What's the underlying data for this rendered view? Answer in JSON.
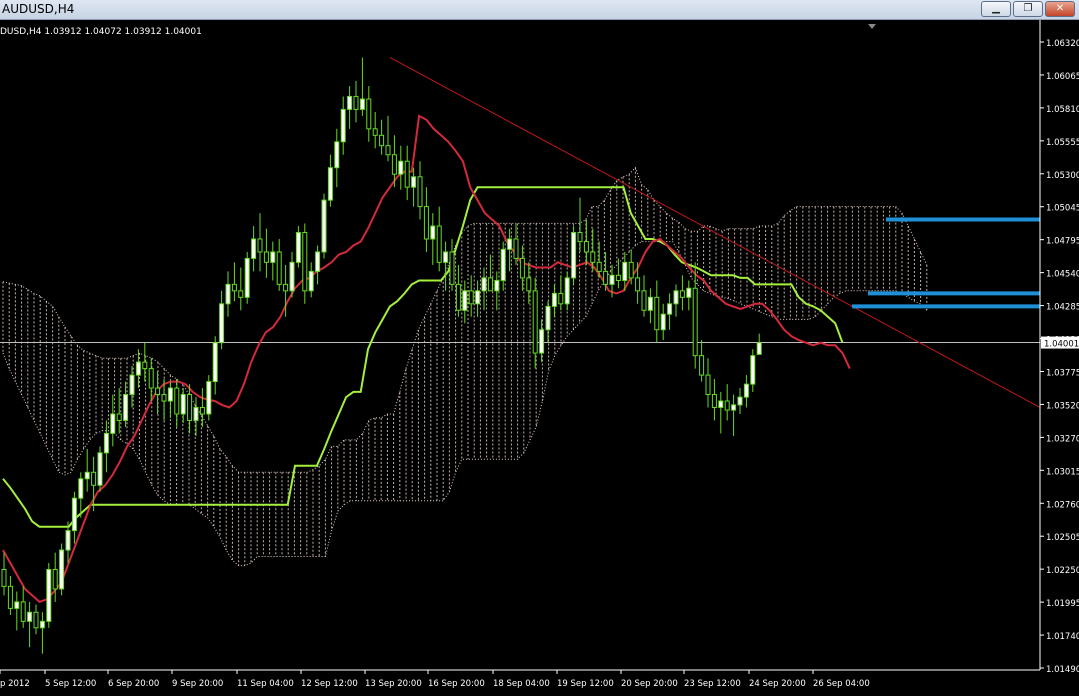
{
  "window": {
    "title": "AUDUSD,H4",
    "buttons": [
      "minimize",
      "restore",
      "close"
    ]
  },
  "chart_data": {
    "type": "candlestick",
    "symbol_info": "DUSD,H4  1.03912 1.04072 1.03912 1.04001",
    "timeframe": "H4",
    "ylim": [
      1.0149,
      1.0632
    ],
    "y_ticks": [
      "1.06320",
      "1.06065",
      "1.05810",
      "1.05555",
      "1.05300",
      "1.05045",
      "1.04795",
      "1.04540",
      "1.04285",
      "1.04030",
      "1.03775",
      "1.03520",
      "1.03270",
      "1.03015",
      "1.02760",
      "1.02505",
      "1.02250",
      "1.01995",
      "1.01740",
      "1.01490"
    ],
    "x_ticks": [
      "p 2012",
      "5 Sep 12:00",
      "6 Sep 20:00",
      "9 Sep 20:00",
      "11 Sep 04:00",
      "12 Sep 12:00",
      "13 Sep 20:00",
      "16 Sep 20:00",
      "18 Sep 04:00",
      "19 Sep 12:00",
      "20 Sep 20:00",
      "23 Sep 12:00",
      "24 Sep 20:00",
      "26 Sep 04:00"
    ],
    "current_price": "1.04001",
    "colors": {
      "background": "#000000",
      "axis_text": "#ffffff",
      "bull_candle": "#ffffff",
      "bear_candle": "#000000",
      "wick": "#66dd22",
      "tenkan": "#d42a3c",
      "kijun": "#a4f03c",
      "cloud": "#e8d0c8",
      "trendline": "#c01818",
      "support_lines": "#1f8fd6",
      "price_line": "#c0c0c0"
    },
    "candles": [
      [
        1.0225,
        1.0238,
        1.0205,
        1.0212
      ],
      [
        1.0212,
        1.022,
        1.019,
        1.0195
      ],
      [
        1.0195,
        1.0208,
        1.0178,
        1.02
      ],
      [
        1.02,
        1.0212,
        1.018,
        1.0185
      ],
      [
        1.0185,
        1.02,
        1.0165,
        1.0192
      ],
      [
        1.0192,
        1.0198,
        1.0175,
        1.018
      ],
      [
        1.018,
        1.0192,
        1.016,
        1.0185
      ],
      [
        1.0185,
        1.023,
        1.018,
        1.0225
      ],
      [
        1.0225,
        1.0238,
        1.02,
        1.021
      ],
      [
        1.021,
        1.0245,
        1.0205,
        1.024
      ],
      [
        1.024,
        1.0262,
        1.023,
        1.0255
      ],
      [
        1.0255,
        1.0285,
        1.0245,
        1.028
      ],
      [
        1.028,
        1.03,
        1.0265,
        1.0295
      ],
      [
        1.0295,
        1.0318,
        1.0285,
        1.03
      ],
      [
        1.03,
        1.0312,
        1.027,
        1.029
      ],
      [
        1.029,
        1.032,
        1.0285,
        1.0315
      ],
      [
        1.0315,
        1.034,
        1.03,
        1.033
      ],
      [
        1.033,
        1.036,
        1.032,
        1.0345
      ],
      [
        1.0345,
        1.0365,
        1.033,
        1.034
      ],
      [
        1.034,
        1.037,
        1.0335,
        1.036
      ],
      [
        1.036,
        1.0382,
        1.035,
        1.0375
      ],
      [
        1.0375,
        1.0395,
        1.0365,
        1.0385
      ],
      [
        1.0385,
        1.04,
        1.037,
        1.038
      ],
      [
        1.038,
        1.0388,
        1.0355,
        1.0365
      ],
      [
        1.0365,
        1.0378,
        1.0345,
        1.036
      ],
      [
        1.036,
        1.0372,
        1.034,
        1.0355
      ],
      [
        1.0355,
        1.037,
        1.0342,
        1.0365
      ],
      [
        1.0365,
        1.0372,
        1.0335,
        1.0345
      ],
      [
        1.0345,
        1.0365,
        1.0338,
        1.036
      ],
      [
        1.036,
        1.0368,
        1.033,
        1.034
      ],
      [
        1.034,
        1.0358,
        1.0328,
        1.035
      ],
      [
        1.035,
        1.0365,
        1.0335,
        1.0345
      ],
      [
        1.0345,
        1.0375,
        1.034,
        1.037
      ],
      [
        1.037,
        1.0405,
        1.036,
        1.04
      ],
      [
        1.04,
        1.044,
        1.0395,
        1.043
      ],
      [
        1.043,
        1.0455,
        1.042,
        1.0445
      ],
      [
        1.0445,
        1.0462,
        1.0432,
        1.044
      ],
      [
        1.044,
        1.0458,
        1.0425,
        1.0435
      ],
      [
        1.0435,
        1.047,
        1.043,
        1.0465
      ],
      [
        1.0465,
        1.049,
        1.0455,
        1.048
      ],
      [
        1.048,
        1.05,
        1.0455,
        1.047
      ],
      [
        1.047,
        1.0488,
        1.045,
        1.0462
      ],
      [
        1.0462,
        1.0478,
        1.0448,
        1.047
      ],
      [
        1.047,
        1.048,
        1.044,
        1.0445
      ],
      [
        1.0445,
        1.046,
        1.042,
        1.044
      ],
      [
        1.044,
        1.047,
        1.0435,
        1.0462
      ],
      [
        1.0462,
        1.049,
        1.0458,
        1.0485
      ],
      [
        1.0485,
        1.0492,
        1.043,
        1.044
      ],
      [
        1.044,
        1.0462,
        1.0435,
        1.0455
      ],
      [
        1.0455,
        1.0475,
        1.0445,
        1.047
      ],
      [
        1.047,
        1.0515,
        1.0465,
        1.051
      ],
      [
        1.051,
        1.0545,
        1.0505,
        1.0535
      ],
      [
        1.0535,
        1.0565,
        1.052,
        1.0555
      ],
      [
        1.0555,
        1.059,
        1.0545,
        1.058
      ],
      [
        1.058,
        1.0598,
        1.0565,
        1.059
      ],
      [
        1.059,
        1.0602,
        1.057,
        1.058
      ],
      [
        1.058,
        1.062,
        1.0575,
        1.0588
      ],
      [
        1.0588,
        1.0598,
        1.0555,
        1.0565
      ],
      [
        1.0565,
        1.0578,
        1.055,
        1.056
      ],
      [
        1.056,
        1.0572,
        1.0545,
        1.0552
      ],
      [
        1.0552,
        1.0575,
        1.054,
        1.0545
      ],
      [
        1.0545,
        1.056,
        1.052,
        1.053
      ],
      [
        1.053,
        1.0552,
        1.0518,
        1.054
      ],
      [
        1.054,
        1.0552,
        1.051,
        1.052
      ],
      [
        1.052,
        1.0535,
        1.0505,
        1.0528
      ],
      [
        1.0528,
        1.054,
        1.0495,
        1.0505
      ],
      [
        1.0505,
        1.052,
        1.047,
        1.048
      ],
      [
        1.048,
        1.05,
        1.046,
        1.049
      ],
      [
        1.049,
        1.0505,
        1.0455,
        1.0462
      ],
      [
        1.0462,
        1.0478,
        1.044,
        1.047
      ],
      [
        1.047,
        1.048,
        1.044,
        1.0445
      ],
      [
        1.0445,
        1.046,
        1.042,
        1.0425
      ],
      [
        1.0425,
        1.0448,
        1.0415,
        1.044
      ],
      [
        1.044,
        1.0452,
        1.042,
        1.043
      ],
      [
        1.043,
        1.0448,
        1.042,
        1.044
      ],
      [
        1.044,
        1.0458,
        1.0425,
        1.045
      ],
      [
        1.045,
        1.0468,
        1.044,
        1.044
      ],
      [
        1.044,
        1.0455,
        1.0425,
        1.0448
      ],
      [
        1.0448,
        1.0478,
        1.044,
        1.0472
      ],
      [
        1.0472,
        1.0488,
        1.0455,
        1.048
      ],
      [
        1.048,
        1.0492,
        1.046,
        1.0465
      ],
      [
        1.0465,
        1.0475,
        1.044,
        1.045
      ],
      [
        1.045,
        1.0462,
        1.043,
        1.044
      ],
      [
        1.044,
        1.045,
        1.038,
        1.0392
      ],
      [
        1.0392,
        1.0418,
        1.0385,
        1.041
      ],
      [
        1.041,
        1.0432,
        1.04,
        1.0428
      ],
      [
        1.0428,
        1.0445,
        1.042,
        1.0438
      ],
      [
        1.0438,
        1.0452,
        1.0425,
        1.043
      ],
      [
        1.043,
        1.0455,
        1.0425,
        1.045
      ],
      [
        1.045,
        1.049,
        1.0445,
        1.0485
      ],
      [
        1.0485,
        1.0512,
        1.047,
        1.0478
      ],
      [
        1.0478,
        1.0495,
        1.046,
        1.047
      ],
      [
        1.047,
        1.0488,
        1.0455,
        1.0462
      ],
      [
        1.0462,
        1.0478,
        1.045,
        1.0455
      ],
      [
        1.0455,
        1.047,
        1.044,
        1.0445
      ],
      [
        1.0445,
        1.046,
        1.0435,
        1.0452
      ],
      [
        1.0452,
        1.0465,
        1.0442,
        1.0448
      ],
      [
        1.0448,
        1.047,
        1.044,
        1.0462
      ],
      [
        1.0462,
        1.0472,
        1.0445,
        1.045
      ],
      [
        1.045,
        1.0462,
        1.043,
        1.044
      ],
      [
        1.044,
        1.0452,
        1.042,
        1.0425
      ],
      [
        1.0425,
        1.0442,
        1.0415,
        1.0435
      ],
      [
        1.0435,
        1.0448,
        1.04,
        1.041
      ],
      [
        1.041,
        1.043,
        1.0402,
        1.0422
      ],
      [
        1.0422,
        1.0438,
        1.041,
        1.043
      ],
      [
        1.043,
        1.0445,
        1.042,
        1.044
      ],
      [
        1.044,
        1.0452,
        1.0425,
        1.0435
      ],
      [
        1.0435,
        1.0448,
        1.0425,
        1.0442
      ],
      [
        1.0442,
        1.0462,
        1.038,
        1.039
      ],
      [
        1.039,
        1.0402,
        1.037,
        1.0375
      ],
      [
        1.0375,
        1.0388,
        1.035,
        1.036
      ],
      [
        1.036,
        1.0372,
        1.034,
        1.035
      ],
      [
        1.035,
        1.0362,
        1.033,
        1.0355
      ],
      [
        1.0355,
        1.0368,
        1.034,
        1.0348
      ],
      [
        1.0348,
        1.036,
        1.0328,
        1.0352
      ],
      [
        1.0352,
        1.0365,
        1.0345,
        1.0358
      ],
      [
        1.0358,
        1.0375,
        1.035,
        1.0368
      ],
      [
        1.0368,
        1.0395,
        1.0362,
        1.039
      ],
      [
        1.0391,
        1.0407,
        1.0391,
        1.04
      ]
    ],
    "tenkan_sen": [
      1.024,
      1.023,
      1.022,
      1.021,
      1.0205,
      1.02,
      1.0202,
      1.0208,
      1.0215,
      1.023,
      1.0245,
      1.026,
      1.0275,
      1.0285,
      1.029,
      1.0298,
      1.0308,
      1.032,
      1.0328,
      1.034,
      1.0352,
      1.0362,
      1.0368,
      1.037,
      1.037,
      1.0368,
      1.0362,
      1.0358,
      1.0356,
      1.0355,
      1.0352,
      1.035,
      1.0355,
      1.0368,
      1.0385,
      1.0398,
      1.0408,
      1.0412,
      1.042,
      1.0432,
      1.0442,
      1.0448,
      1.045,
      1.0455,
      1.0458,
      1.0462,
      1.0468,
      1.047,
      1.0475,
      1.0478,
      1.0488,
      1.05,
      1.0512,
      1.052,
      1.0528,
      1.0532,
      1.0532,
      1.0575,
      1.0572,
      1.0565,
      1.056,
      1.0555,
      1.0548,
      1.054,
      1.052,
      1.051,
      1.05,
      1.0495,
      1.049,
      1.0478,
      1.047,
      1.0462,
      1.046,
      1.0458,
      1.0458,
      1.0458,
      1.0462,
      1.046,
      1.0458,
      1.046,
      1.0462,
      1.0458,
      1.045,
      1.044,
      1.0438,
      1.044,
      1.045,
      1.0458,
      1.047,
      1.0478,
      1.048,
      1.0475,
      1.047,
      1.0465,
      1.0458,
      1.0452,
      1.0448,
      1.044,
      1.0435,
      1.043,
      1.0428,
      1.0426,
      1.0428,
      1.043,
      1.043,
      1.0425,
      1.0418,
      1.041,
      1.0405,
      1.0402,
      1.04,
      1.0398,
      1.04,
      1.0398,
      1.0398,
      1.0392,
      1.038
    ],
    "kijun_sen": [
      1.0295,
      1.0288,
      1.028,
      1.0272,
      1.0262,
      1.0258,
      1.0258,
      1.0258,
      1.0258,
      1.0258,
      1.0265,
      1.027,
      1.0275,
      1.0275,
      1.0275,
      1.0275,
      1.0275,
      1.0275,
      1.0275,
      1.0275,
      1.0275,
      1.0275,
      1.0275,
      1.0275,
      1.0275,
      1.0275,
      1.0275,
      1.0275,
      1.0275,
      1.0275,
      1.0275,
      1.0275,
      1.0275,
      1.0275,
      1.0275,
      1.0275,
      1.0275,
      1.0275,
      1.0275,
      1.0275,
      1.0305,
      1.0305,
      1.0305,
      1.0305,
      1.0318,
      1.0332,
      1.0345,
      1.0358,
      1.0362,
      1.0362,
      1.0395,
      1.0408,
      1.0418,
      1.0428,
      1.0432,
      1.0438,
      1.0445,
      1.0448,
      1.0448,
      1.0448,
      1.0448,
      1.0455,
      1.0472,
      1.049,
      1.051,
      1.052,
      1.052,
      1.052,
      1.052,
      1.052,
      1.052,
      1.052,
      1.052,
      1.052,
      1.052,
      1.052,
      1.052,
      1.052,
      1.052,
      1.052,
      1.052,
      1.052,
      1.052,
      1.052,
      1.052,
      1.052,
      1.05,
      1.049,
      1.048,
      1.048,
      1.0478,
      1.0475,
      1.0468,
      1.0462,
      1.046,
      1.0458,
      1.0455,
      1.0452,
      1.0452,
      1.0452,
      1.0452,
      1.045,
      1.045,
      1.0445,
      1.0445,
      1.0445,
      1.0445,
      1.0445,
      1.0445,
      1.0435,
      1.043,
      1.0428,
      1.0425,
      1.042,
      1.0415,
      1.04
    ],
    "cloud_upper": [
      1.0447,
      1.0446,
      1.0445,
      1.0444,
      1.0441,
      1.0438,
      1.0436,
      1.0432,
      1.0428,
      1.042,
      1.0412,
      1.0405,
      1.0398,
      1.0394,
      1.0392,
      1.039,
      1.0388,
      1.0388,
      1.0388,
      1.0388,
      1.0388,
      1.039,
      1.0392,
      1.039,
      1.0388,
      1.0385,
      1.038,
      1.0375,
      1.0372,
      1.0368,
      1.036,
      1.0352,
      1.0344,
      1.0336,
      1.0328,
      1.0318,
      1.0312,
      1.0305,
      1.03,
      1.03,
      1.03,
      1.03,
      1.03,
      1.03,
      1.03,
      1.03,
      1.03,
      1.03,
      1.03,
      1.03,
      1.0302,
      1.0305,
      1.031,
      1.032,
      1.032,
      1.0325,
      1.0325,
      1.0325,
      1.033,
      1.034,
      1.0342,
      1.0342,
      1.0345,
      1.0345,
      1.0362,
      1.038,
      1.0395,
      1.041,
      1.042,
      1.043,
      1.044,
      1.045,
      1.0462,
      1.0475,
      1.0485,
      1.049,
      1.0492,
      1.0492,
      1.0492,
      1.0492,
      1.0492,
      1.0492,
      1.0492,
      1.0492,
      1.0492,
      1.0492,
      1.0492,
      1.0492,
      1.0492,
      1.0492,
      1.0492,
      1.0492,
      1.0492,
      1.0492,
      1.0495,
      1.0505,
      1.0505,
      1.051,
      1.0518,
      1.0525,
      1.0528,
      1.053,
      1.0535,
      1.0522,
      1.0518,
      1.051,
      1.0505,
      1.05,
      1.0496,
      1.0493,
      1.0488,
      1.0486,
      1.0486,
      1.049,
      1.049,
      1.0488,
      1.0486,
      1.0488,
      1.0488,
      1.0488,
      1.0488,
      1.0488,
      1.049,
      1.049,
      1.049,
      1.0492,
      1.0498,
      1.0502,
      1.0505,
      1.0505,
      1.0505,
      1.0505,
      1.0505,
      1.0505,
      1.0505,
      1.0505,
      1.0505,
      1.0505,
      1.0505,
      1.0505,
      1.0505,
      1.0505,
      1.0505,
      1.0505,
      1.0505,
      1.05,
      1.049,
      1.048,
      1.047,
      1.046
    ],
    "cloud_lower": [
      1.0392,
      1.038,
      1.037,
      1.036,
      1.035,
      1.034,
      1.033,
      1.032,
      1.031,
      1.03,
      1.0298,
      1.03,
      1.031,
      1.0318,
      1.0325,
      1.033,
      1.0332,
      1.0332,
      1.033,
      1.0325,
      1.0322,
      1.0318,
      1.031,
      1.03,
      1.029,
      1.0282,
      1.0278,
      1.0275,
      1.0275,
      1.0275,
      1.0275,
      1.0272,
      1.0268,
      1.0265,
      1.0258,
      1.025,
      1.024,
      1.0232,
      1.0228,
      1.0228,
      1.023,
      1.0235,
      1.0235,
      1.0235,
      1.0235,
      1.0235,
      1.0235,
      1.0235,
      1.0235,
      1.0235,
      1.0235,
      1.0235,
      1.0235,
      1.0255,
      1.027,
      1.0275,
      1.0278,
      1.0278,
      1.0278,
      1.0278,
      1.0278,
      1.0278,
      1.0278,
      1.0278,
      1.0278,
      1.0278,
      1.0278,
      1.0278,
      1.0278,
      1.0278,
      1.0278,
      1.0278,
      1.0285,
      1.03,
      1.031,
      1.031,
      1.031,
      1.031,
      1.031,
      1.031,
      1.031,
      1.031,
      1.031,
      1.031,
      1.0315,
      1.0325,
      1.0335,
      1.0355,
      1.0378,
      1.039,
      1.0398,
      1.0405,
      1.041,
      1.0415,
      1.042,
      1.043,
      1.044,
      1.0448,
      1.0455,
      1.046,
      1.0465,
      1.047,
      1.0475,
      1.0478,
      1.0478,
      1.0478,
      1.0478,
      1.0478,
      1.0478,
      1.047,
      1.046,
      1.045,
      1.0445,
      1.044,
      1.0438,
      1.0436,
      1.0435,
      1.0434,
      1.0432,
      1.043,
      1.0428,
      1.0426,
      1.0424,
      1.0422,
      1.042,
      1.0418,
      1.0418,
      1.0418,
      1.0418,
      1.0418,
      1.0418,
      1.042,
      1.0425,
      1.043,
      1.0435,
      1.0438,
      1.044,
      1.044,
      1.044,
      1.044,
      1.044,
      1.044,
      1.044,
      1.044,
      1.044,
      1.0438,
      1.0435,
      1.0432,
      1.043,
      1.0425
    ],
    "trendline": {
      "from": [
        1.062
      ],
      "to": [
        1.035
      ]
    },
    "support_lines": [
      1.0495,
      1.0438,
      1.0428
    ]
  }
}
